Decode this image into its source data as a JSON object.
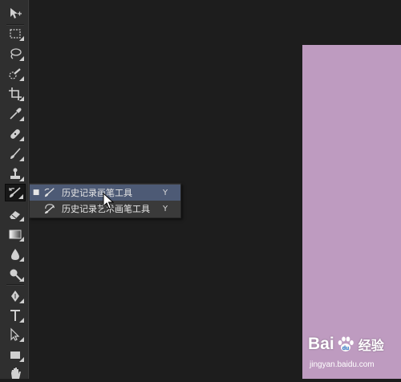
{
  "toolbar": {
    "tools": [
      {
        "name": "move-tool",
        "icon": "move-icon"
      },
      {
        "name": "marquee-tool",
        "icon": "rect-marquee-icon"
      },
      {
        "name": "lasso-tool",
        "icon": "lasso-icon"
      },
      {
        "name": "quick-select-tool",
        "icon": "quick-select-icon"
      },
      {
        "name": "crop-tool",
        "icon": "crop-icon"
      },
      {
        "name": "eyedropper-tool",
        "icon": "eyedropper-icon"
      },
      {
        "name": "healing-brush-tool",
        "icon": "bandage-icon"
      },
      {
        "name": "brush-tool",
        "icon": "brush-icon"
      },
      {
        "name": "clone-stamp-tool",
        "icon": "stamp-icon"
      },
      {
        "name": "history-brush-tool",
        "icon": "history-brush-icon",
        "active": true
      },
      {
        "name": "eraser-tool",
        "icon": "eraser-icon"
      },
      {
        "name": "gradient-tool",
        "icon": "gradient-icon"
      },
      {
        "name": "blur-tool",
        "icon": "droplet-icon"
      },
      {
        "name": "dodge-tool",
        "icon": "dodge-icon"
      },
      {
        "name": "pen-tool",
        "icon": "pen-icon"
      },
      {
        "name": "type-tool",
        "icon": "type-icon"
      },
      {
        "name": "path-select-tool",
        "icon": "arrow-select-icon"
      },
      {
        "name": "shape-tool",
        "icon": "rectangle-icon"
      },
      {
        "name": "hand-tool",
        "icon": "hand-icon"
      }
    ]
  },
  "flyout": {
    "items": [
      {
        "label": "历史记录画笔工具",
        "shortcut": "Y",
        "selected": true,
        "icon": "history-brush-icon"
      },
      {
        "label": "历史记录艺术画笔工具",
        "shortcut": "Y",
        "selected": false,
        "icon": "art-history-brush-icon"
      }
    ]
  },
  "canvas": {
    "document_color": "#be9bc0",
    "workspace_color": "#1d1d1d"
  },
  "watermark": {
    "logo_left": "Bai",
    "logo_right": "",
    "logo_cn": "经验",
    "url": "jingyan.baidu.com"
  }
}
